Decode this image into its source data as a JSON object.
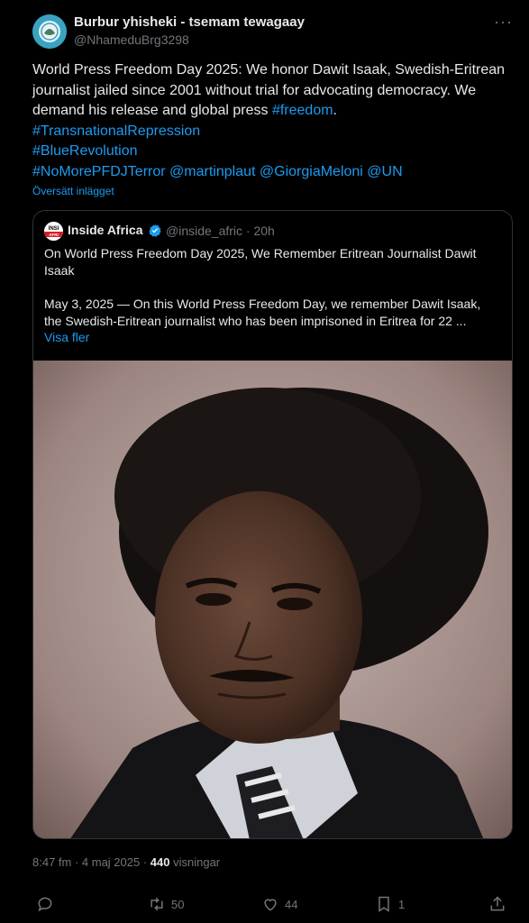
{
  "author": {
    "name": "Burbur yhisheki - tsemam tewagaay",
    "handle": "@NhameduBrg3298",
    "avatar_icon": "emblem-avatar"
  },
  "more_icon": "more-options-icon",
  "body": {
    "line1": "World Press Freedom Day 2025: We honor Dawit Isaak, Swedish-Eritrean journalist jailed since 2001 without trial for advocating democracy. We demand his release and global press ",
    "hashtag_freedom": "#freedom",
    "period": ".",
    "hashtag_transnational": "#TransnationalRepression",
    "hashtag_blue": "#BlueRevolution",
    "hashtag_nomore": "#NoMorePFDJTerror",
    "mention_plaut": "@martinplaut",
    "mention_meloni": "@GiorgiaMeloni",
    "mention_un": "@UN"
  },
  "translate_label": "Översätt inlägget",
  "quote": {
    "avatar_text_top": "INSI",
    "avatar_text_bottom": "AFRI",
    "name": "Inside Africa",
    "handle_time": "@inside_afric · 20h",
    "title": "On World Press Freedom Day 2025, We Remember Eritrean Journalist Dawit Isaak",
    "desc": "May 3, 2025 — On this World Press Freedom Day, we remember Dawit Isaak, the Swedish-Eritrean journalist who has been imprisoned in Eritrea for 22 ...",
    "more_label": "Visa fler"
  },
  "meta": {
    "time_date": "8:47 fm · 4 maj 2025 · ",
    "views_count": "440",
    "views_label": " visningar"
  },
  "actions": {
    "reply_count": "",
    "retweet_count": "50",
    "like_count": "44",
    "bookmark_count": "1"
  },
  "colors": {
    "background": "#000000",
    "text": "#e7e9ea",
    "muted": "#71767b",
    "link": "#1d9bf0",
    "border": "#2f3336"
  }
}
